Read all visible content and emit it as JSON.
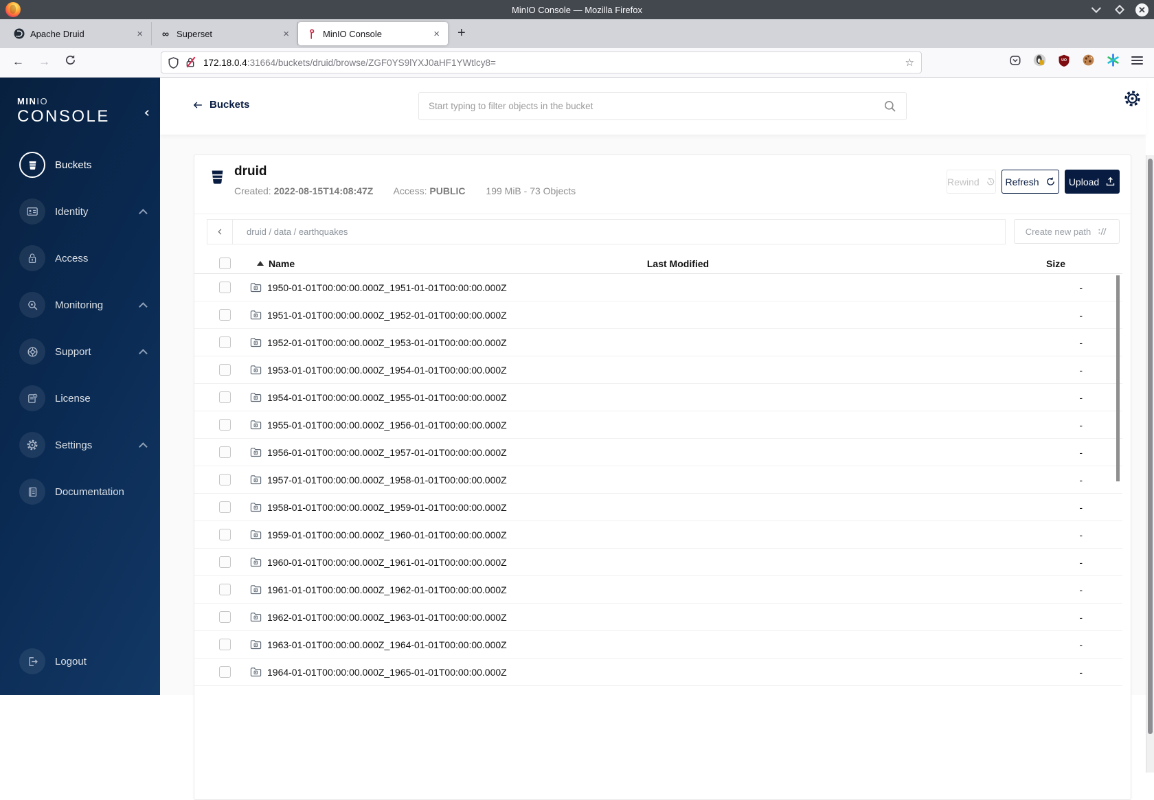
{
  "colors": {
    "navy": "#081C42",
    "minio_red": "#C72C48",
    "sidebar_from": "#08203f",
    "sidebar_to": "#123865",
    "ublock_red": "#7d0c10"
  },
  "titlebar": {
    "title": "MinIO Console — Mozilla Firefox"
  },
  "tabbar": {
    "close_glyph": "×",
    "new_tab_glyph": "+",
    "superset_glyph": "∞"
  },
  "tabs": [
    {
      "label": "Apache Druid"
    },
    {
      "label": "Superset"
    },
    {
      "label": "MinIO Console"
    }
  ],
  "urlbar": {
    "host": "172.18.0.4",
    "rest": ":31664/buckets/druid/browse/ZGF0YS9lYXJ0aHF1YWtlcy8=",
    "back_glyph": "←",
    "forward_glyph": "→",
    "star_glyph": "☆"
  },
  "sidebar": {
    "brand_min": "MIN",
    "brand_io": "IO",
    "brand_console": "CONSOLE",
    "items": [
      {
        "label": "Buckets"
      },
      {
        "label": "Identity"
      },
      {
        "label": "Access"
      },
      {
        "label": "Monitoring"
      },
      {
        "label": "Support"
      },
      {
        "label": "License"
      },
      {
        "label": "Settings"
      },
      {
        "label": "Documentation"
      }
    ],
    "logout_label": "Logout"
  },
  "header": {
    "back_label": "Buckets",
    "search_placeholder": "Start typing to filter objects in the bucket"
  },
  "bucket": {
    "name": "druid",
    "created_label": "Created:",
    "created_value": "2022-08-15T14:08:47Z",
    "access_label": "Access:",
    "access_value": "PUBLIC",
    "summary": "199 MiB - 73 Objects",
    "rewind_label": "Rewind",
    "refresh_label": "Refresh",
    "upload_label": "Upload"
  },
  "browse": {
    "breadcrumb": "druid / data / earthquakes",
    "create_path_label": "Create new path"
  },
  "objects": {
    "columns": {
      "name": "Name",
      "modified": "Last Modified",
      "size": "Size"
    },
    "rows": [
      {
        "name": "1950-01-01T00:00:00.000Z_1951-01-01T00:00:00.000Z",
        "size": "-"
      },
      {
        "name": "1951-01-01T00:00:00.000Z_1952-01-01T00:00:00.000Z",
        "size": "-"
      },
      {
        "name": "1952-01-01T00:00:00.000Z_1953-01-01T00:00:00.000Z",
        "size": "-"
      },
      {
        "name": "1953-01-01T00:00:00.000Z_1954-01-01T00:00:00.000Z",
        "size": "-"
      },
      {
        "name": "1954-01-01T00:00:00.000Z_1955-01-01T00:00:00.000Z",
        "size": "-"
      },
      {
        "name": "1955-01-01T00:00:00.000Z_1956-01-01T00:00:00.000Z",
        "size": "-"
      },
      {
        "name": "1956-01-01T00:00:00.000Z_1957-01-01T00:00:00.000Z",
        "size": "-"
      },
      {
        "name": "1957-01-01T00:00:00.000Z_1958-01-01T00:00:00.000Z",
        "size": "-"
      },
      {
        "name": "1958-01-01T00:00:00.000Z_1959-01-01T00:00:00.000Z",
        "size": "-"
      },
      {
        "name": "1959-01-01T00:00:00.000Z_1960-01-01T00:00:00.000Z",
        "size": "-"
      },
      {
        "name": "1960-01-01T00:00:00.000Z_1961-01-01T00:00:00.000Z",
        "size": "-"
      },
      {
        "name": "1961-01-01T00:00:00.000Z_1962-01-01T00:00:00.000Z",
        "size": "-"
      },
      {
        "name": "1962-01-01T00:00:00.000Z_1963-01-01T00:00:00.000Z",
        "size": "-"
      },
      {
        "name": "1963-01-01T00:00:00.000Z_1964-01-01T00:00:00.000Z",
        "size": "-"
      },
      {
        "name": "1964-01-01T00:00:00.000Z_1965-01-01T00:00:00.000Z",
        "size": "-"
      }
    ]
  }
}
